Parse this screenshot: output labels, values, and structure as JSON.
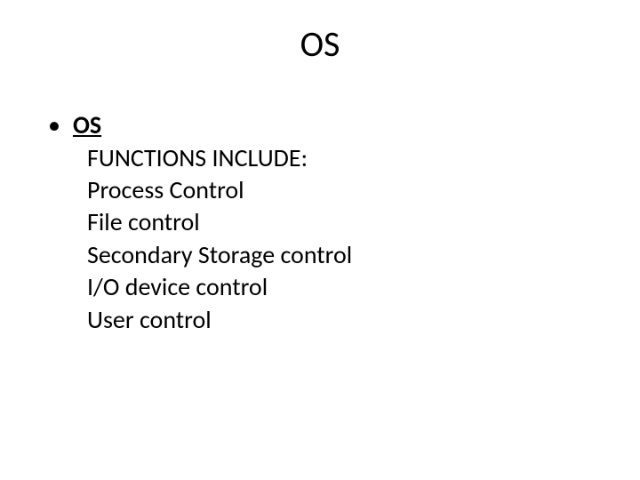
{
  "title": "OS",
  "bullet": {
    "heading": "OS",
    "lines": [
      "FUNCTIONS INCLUDE:",
      "Process Control",
      "File control",
      "Secondary Storage control",
      "I/O device control",
      "User control"
    ]
  }
}
